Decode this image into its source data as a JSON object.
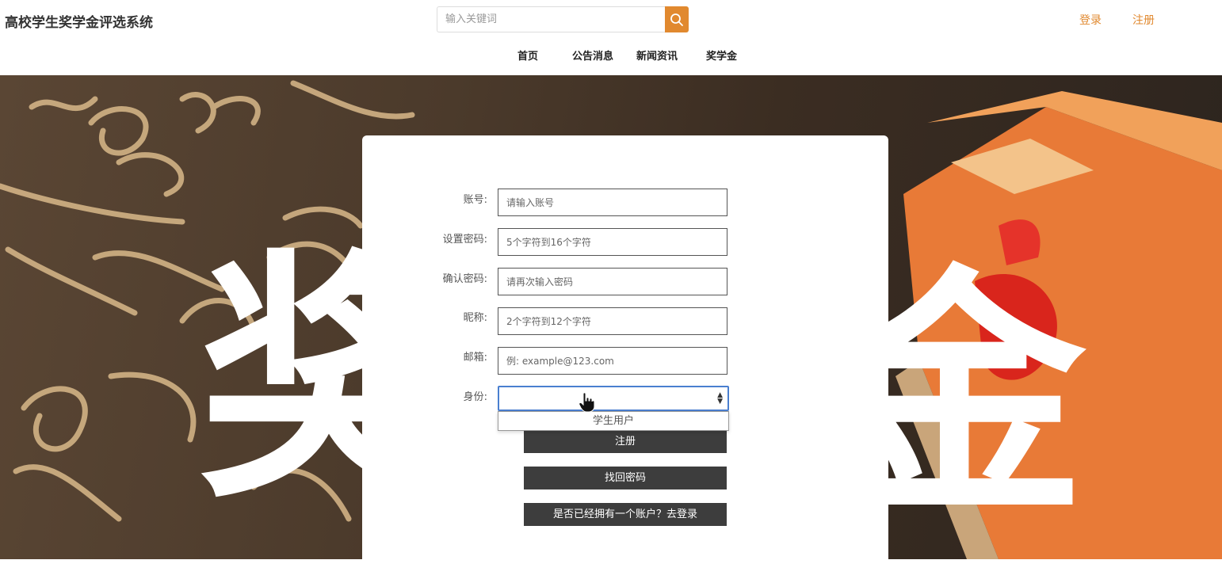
{
  "header": {
    "site_title": "高校学生奖学金评选系统",
    "search_placeholder": "输入关键词",
    "search_icon": "search-icon",
    "login_label": "登录",
    "register_label": "注册",
    "accent_color": "#e1892f"
  },
  "nav": {
    "items": [
      "首页",
      "公告消息",
      "新闻资讯",
      "奖学金"
    ]
  },
  "hero": {
    "banner_text_left": "奖",
    "banner_text_right": "金"
  },
  "form": {
    "account_label": "账号:",
    "account_placeholder": "请输入账号",
    "password_label": "设置密码:",
    "password_placeholder": "5个字符到16个字符",
    "confirm_label": "确认密码:",
    "confirm_placeholder": "请再次输入密码",
    "nickname_label": "昵称:",
    "nickname_placeholder": "2个字符到12个字符",
    "email_label": "邮箱:",
    "email_placeholder": "例: example@123.com",
    "identity_label": "身份:",
    "identity_value": "",
    "identity_options": [
      "学生用户"
    ],
    "register_button": "注册",
    "recover_button": "找回密码",
    "login_button": "是否已经拥有一个账户？去登录"
  }
}
